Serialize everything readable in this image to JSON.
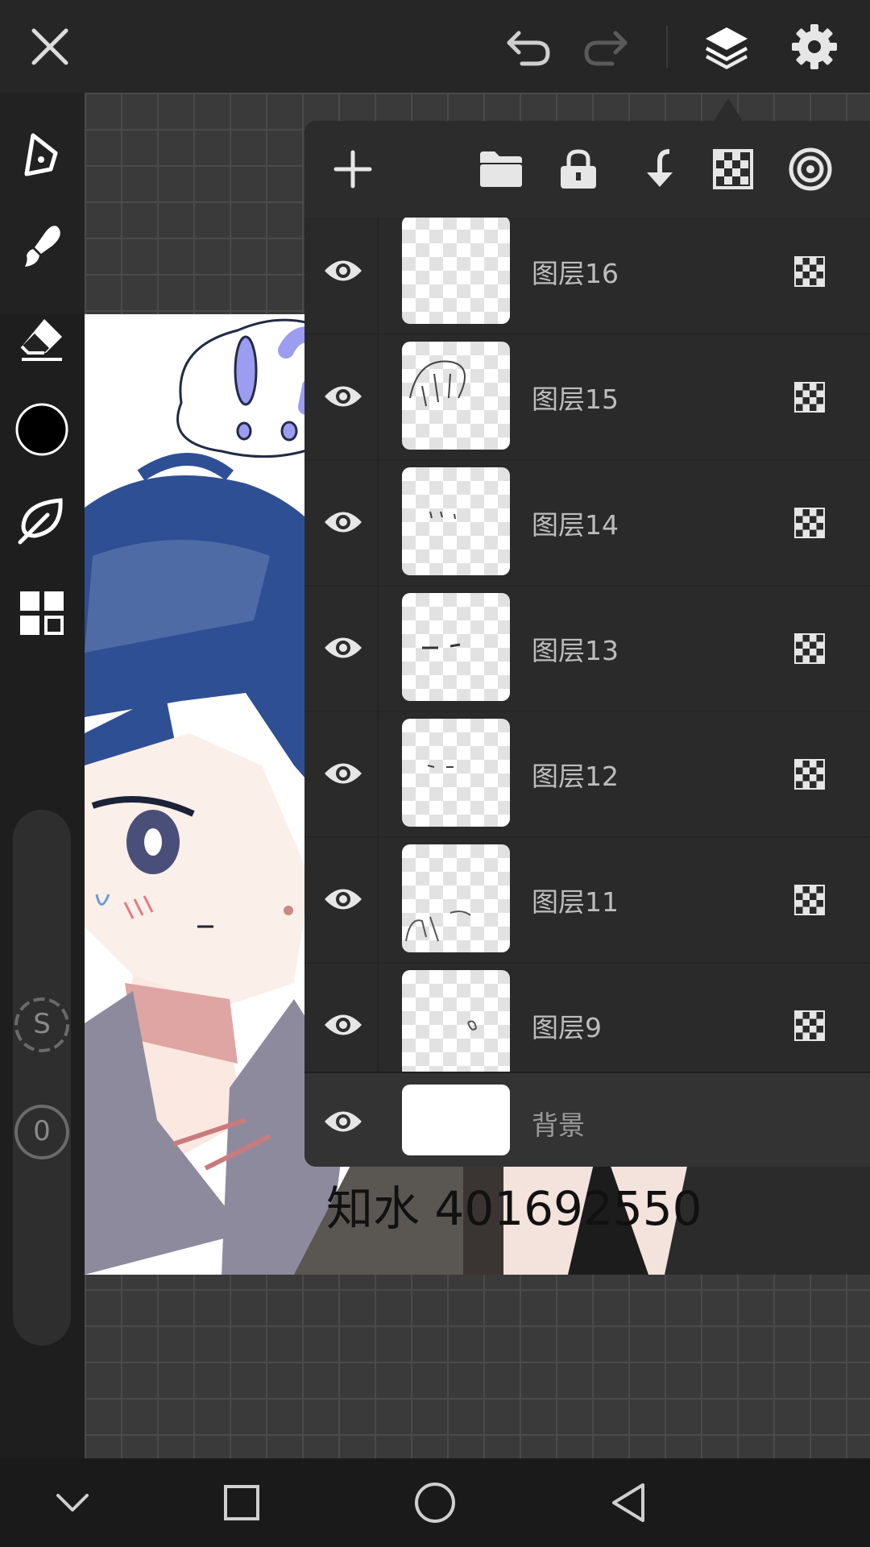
{
  "top_bar": {
    "icons": [
      "close-icon",
      "undo-icon",
      "redo-icon",
      "layers-icon",
      "settings-icon"
    ]
  },
  "left_tools": {
    "icons": [
      "pen-icon",
      "brush-icon",
      "eraser-icon",
      "color-swatch",
      "leaf-icon",
      "grid-icon"
    ],
    "current_color": "#000000",
    "size_label": "S",
    "opacity_label": "0"
  },
  "layer_panel": {
    "toolbar_icons": [
      "add-layer-icon",
      "folder-icon",
      "lock-icon",
      "merge-down-icon",
      "transparency-icon",
      "target-icon"
    ],
    "layers": [
      {
        "name": "图层16",
        "visible": true
      },
      {
        "name": "图层15",
        "visible": true
      },
      {
        "name": "图层14",
        "visible": true
      },
      {
        "name": "图层13",
        "visible": true
      },
      {
        "name": "图层12",
        "visible": true
      },
      {
        "name": "图层11",
        "visible": true
      },
      {
        "name": "图层9",
        "visible": true
      }
    ],
    "background_layer": {
      "name": "背景",
      "visible": true
    }
  },
  "artwork": {
    "signature_text": "知水 401692550"
  },
  "nav_bar": {
    "icons": [
      "chevron-down-icon",
      "recents-icon",
      "home-icon",
      "back-icon"
    ]
  },
  "colors": {
    "hair_blue": "#2f4f94",
    "accent_purple": "#9c9cf0",
    "panel_bg": "#2c2c2c"
  }
}
